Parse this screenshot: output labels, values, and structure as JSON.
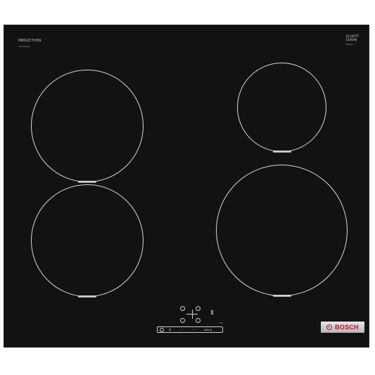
{
  "product": {
    "technology_label": "INDUCTION",
    "technology_sublabel": "TouchSelect",
    "glass_brand_line1": "SCHOTT",
    "glass_brand_line2": "CERAN",
    "glass_brand_sub": "BOSCH",
    "brand": "BOSCH",
    "brand_color": "#c0101a"
  },
  "controls": {
    "strip": {
      "power_icon": "power-icon",
      "timer_label": "⏲",
      "minus_label": "−",
      "plus_label": "+",
      "zone_label": "auto ⌀",
      "tag": "SRS"
    }
  },
  "zones": [
    {
      "name": "front-left",
      "icon": "cooking-zone"
    },
    {
      "name": "back-right",
      "icon": "cooking-zone"
    },
    {
      "name": "front-left-lower",
      "icon": "cooking-zone"
    },
    {
      "name": "front-right",
      "icon": "cooking-zone"
    }
  ]
}
